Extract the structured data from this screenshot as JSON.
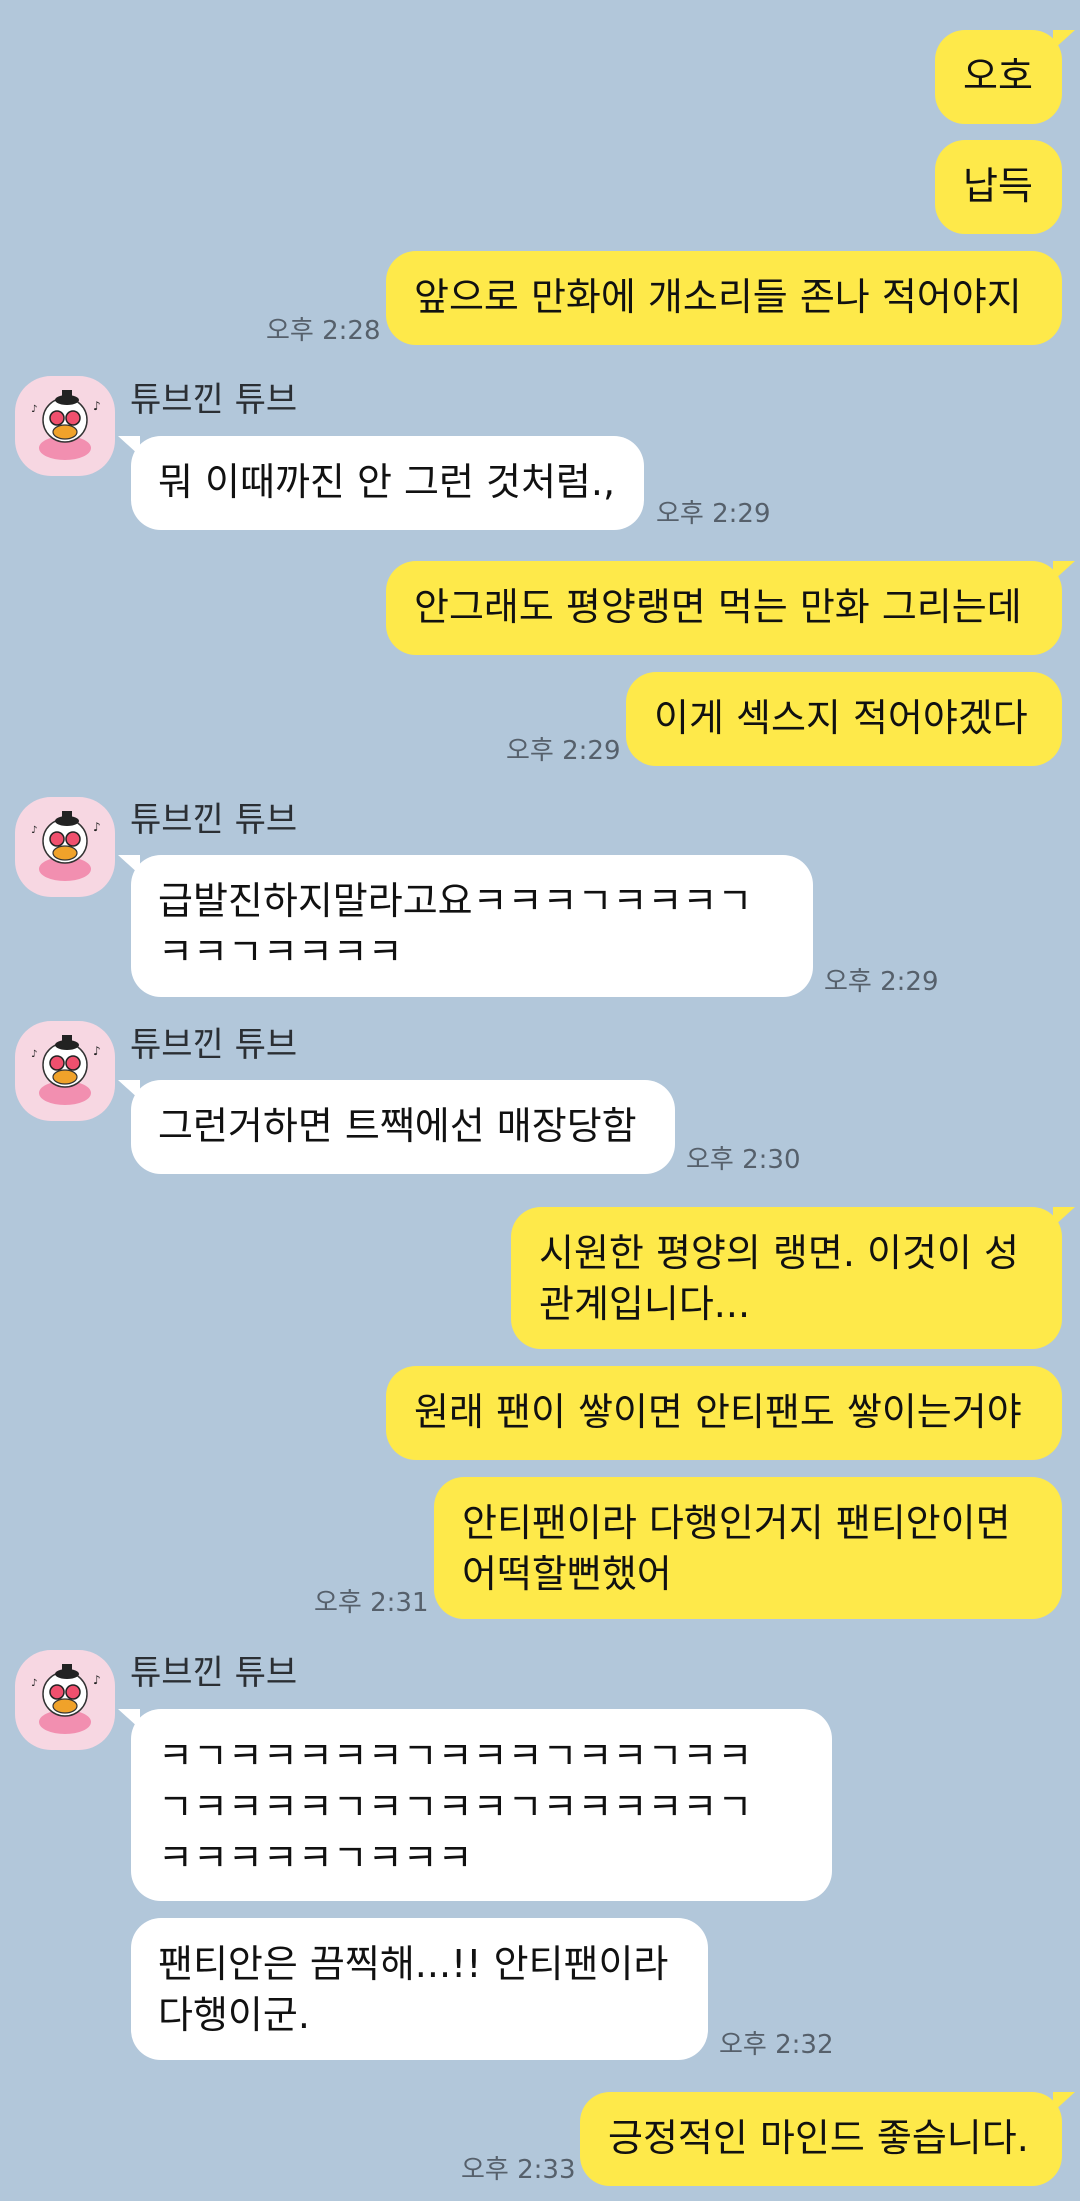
{
  "contact": {
    "name": "튜브낀 튜브",
    "avatar_icon": "tube-duck-character-icon"
  },
  "colors": {
    "background": "#b2c7da",
    "mine_bubble": "#fee94a",
    "their_bubble": "#ffffff",
    "timestamp": "#56606b"
  },
  "messages": [
    {
      "from": "me",
      "text": "오호"
    },
    {
      "from": "me",
      "text": "납득"
    },
    {
      "from": "me",
      "text": "앞으로 만화에 개소리들 존나 적어야지",
      "time": "오후 2:28"
    },
    {
      "from": "them",
      "sender": "튜브낀 튜브",
      "text": "뭐 이때까진 안 그런 것처럼.,",
      "time": "오후 2:29"
    },
    {
      "from": "me",
      "text": "안그래도 평양랭면 먹는 만화 그리는데"
    },
    {
      "from": "me",
      "text": "이게 섹스지 적어야겠다",
      "time": "오후 2:29"
    },
    {
      "from": "them",
      "sender": "튜브낀 튜브",
      "lines": [
        "급발진하지말라고요ㅋㅋㅋㄱㅋㅋㅋㄱ",
        "ㅋㅋㄱㅋㅋㅋㅋ"
      ],
      "time": "오후 2:29"
    },
    {
      "from": "them",
      "sender": "튜브낀 튜브",
      "text": "그런거하면 트짹에선 매장당함",
      "time": "오후 2:30"
    },
    {
      "from": "me",
      "lines": [
        "시원한 평양의 랭면. 이것이 성",
        "관계입니다..."
      ]
    },
    {
      "from": "me",
      "text": "원래 팬이 쌓이면 안티팬도 쌓이는거야"
    },
    {
      "from": "me",
      "lines": [
        "안티팬이라 다행인거지 팬티안이면",
        "어떡할뻔했어"
      ],
      "time": "오후 2:31"
    },
    {
      "from": "them",
      "sender": "튜브낀 튜브",
      "lines": [
        "ㅋㄱㅋㅋㅋㅋㅋㄱㅋㅋㅋㄱㅋㅋㄱㅋㅋ",
        "ㄱㅋㅋㅋㅋㄱㅋㄱㅋㅋㄱㅋㅋㅋㅋㅋㄱ",
        "ㅋㅋㅋㅋㅋㄱㅋㅋㅋ"
      ]
    },
    {
      "from": "them",
      "lines": [
        "팬티안은 끔찍해...!!  안티팬이라",
        "다행이군."
      ],
      "time": "오후 2:32"
    },
    {
      "from": "me",
      "text": "긍정적인 마인드 좋습니다.",
      "time": "오후 2:33"
    }
  ]
}
